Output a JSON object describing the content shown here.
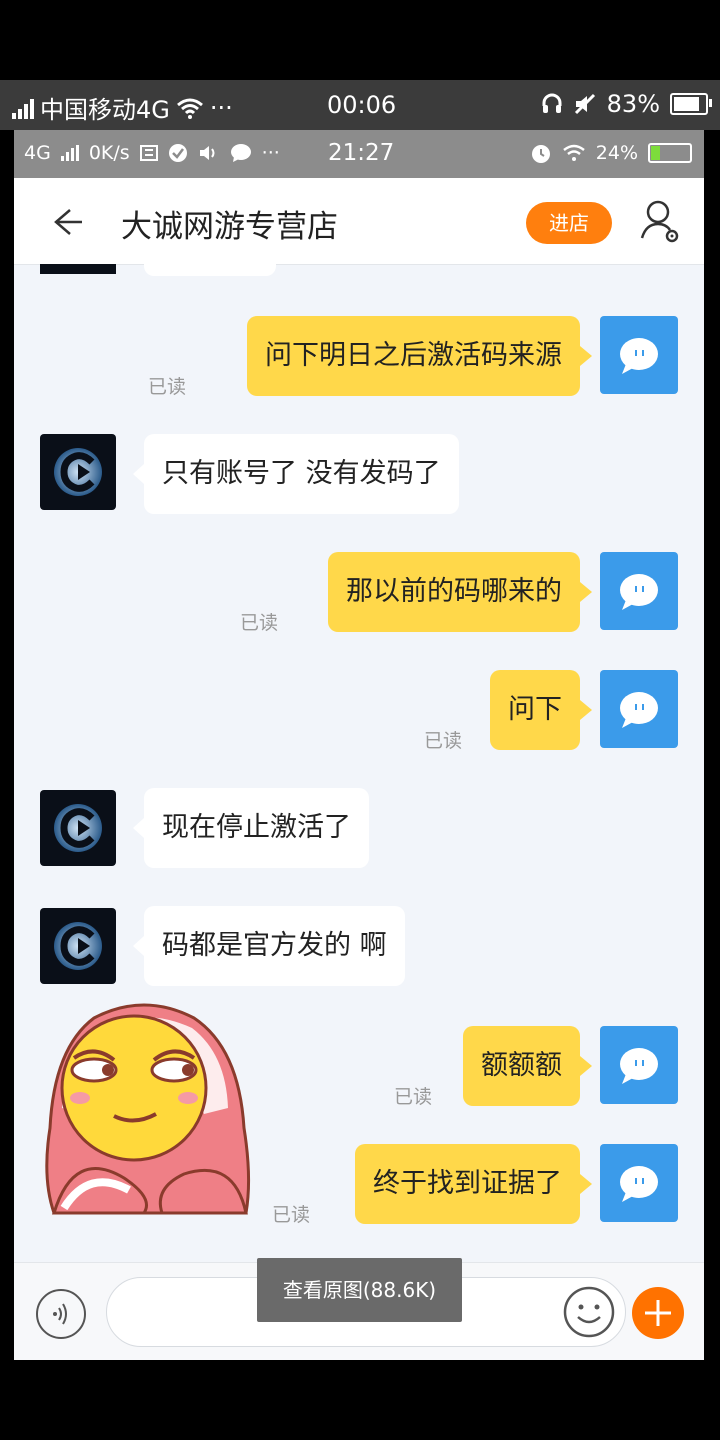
{
  "outer_status": {
    "carrier": "中国移动4G",
    "more": "···",
    "time": "00:06",
    "battery": "83%",
    "battery_level": 0.83
  },
  "inner_status": {
    "network": "4G",
    "speed": "0K/s",
    "more": "···",
    "time": "21:27",
    "battery": "24%",
    "battery_level": 0.24
  },
  "header": {
    "title": "大诚网游专营店",
    "enter_shop": "进店",
    "back_icon": "back-arrow-icon",
    "settings_icon": "user-settings-icon"
  },
  "messages": [
    {
      "side": "me",
      "text": "问下明日之后激活码来源",
      "status": "已读"
    },
    {
      "side": "them",
      "text": "只有账号了  没有发码了"
    },
    {
      "side": "me",
      "text": "那以前的码哪来的",
      "status": "已读"
    },
    {
      "side": "me",
      "text": "问下",
      "status": "已读"
    },
    {
      "side": "them",
      "text": "现在停止激活了"
    },
    {
      "side": "them",
      "text": "码都是官方发的 啊"
    },
    {
      "side": "me",
      "text": "额额额",
      "status": "已读"
    },
    {
      "side": "me",
      "text": "终于找到证据了",
      "status": "已读"
    }
  ],
  "toast": {
    "label": "查看原图(88.6K)"
  },
  "colors": {
    "accent_orange": "#ff7f0e",
    "my_bubble": "#ffd84a",
    "my_avatar": "#3b9bea",
    "chat_bg": "#f2f5fa"
  }
}
